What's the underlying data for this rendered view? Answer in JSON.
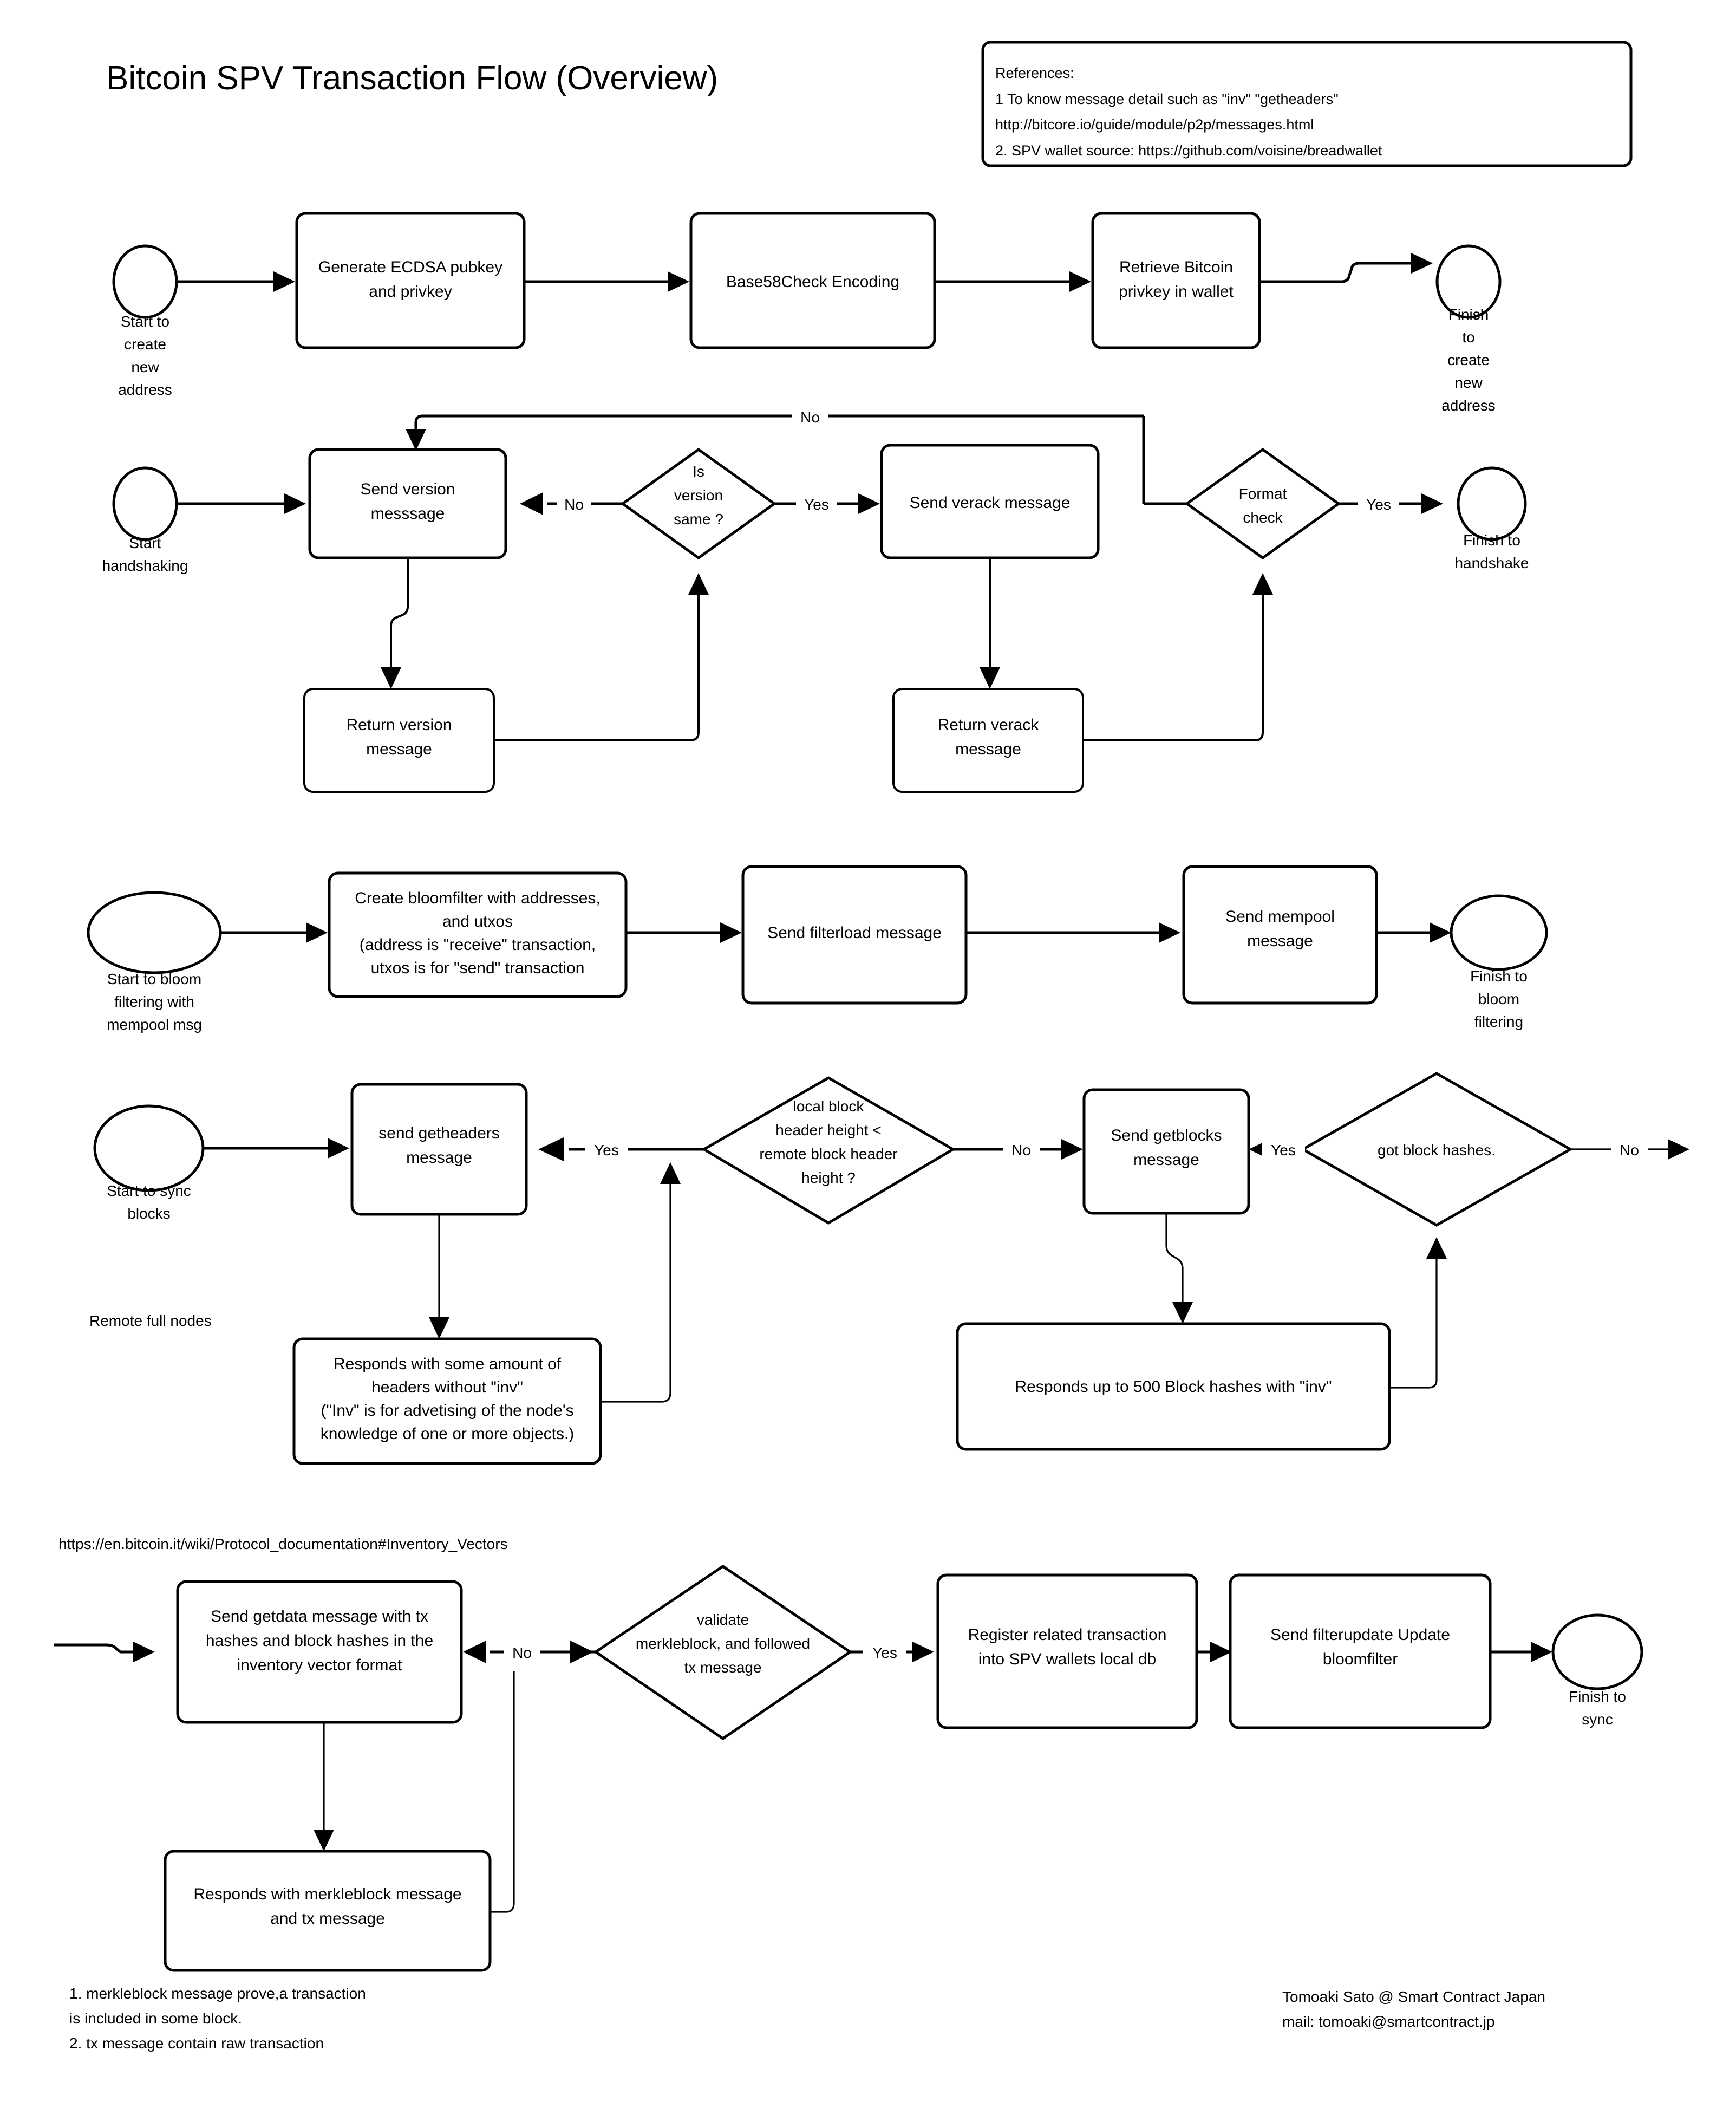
{
  "page": {
    "title": "Bitcoin SPV Transaction Flow (Overview)",
    "background": "#ffffff",
    "stroke": "#000000"
  },
  "references": {
    "lines": [
      "References:",
      "1 To know message detail such as \"inv\" \"getheaders\"",
      "http://bitcore.io/guide/module/p2p/messages.html",
      "2. SPV wallet source:  https://github.com/voisine/breadwallet"
    ]
  },
  "lane1": {
    "start": "Start to\ncreate\nnew\naddress",
    "start_lines": [
      "Start to",
      "create",
      "new",
      "address"
    ],
    "steps": [
      {
        "lines": [
          "Generate ECDSA pubkey",
          "and privkey"
        ]
      },
      {
        "lines": [
          "Base58Check Encoding"
        ]
      },
      {
        "lines": [
          "Retrieve Bitcoin",
          "privkey in wallet"
        ]
      }
    ],
    "finish_lines": [
      "Finish",
      "to",
      "create",
      "new",
      "address"
    ]
  },
  "lane2": {
    "start_lines": [
      "Start",
      "handshaking"
    ],
    "send_version_lines": [
      "Send version",
      "messsage"
    ],
    "is_version_same_lines": [
      "Is",
      "version",
      "same ?"
    ],
    "send_verack_lines": [
      "Send verack message"
    ],
    "format_check_lines": [
      "Format",
      "check"
    ],
    "finish_lines": [
      "Finish to",
      "handshake"
    ],
    "return_version_lines": [
      "Return version",
      "message"
    ],
    "return_verack_lines": [
      "Return verack",
      "message"
    ],
    "labels": {
      "no_top": "No",
      "no_left": "No",
      "yes_mid": "Yes",
      "yes_right": "Yes"
    }
  },
  "lane3": {
    "start_lines": [
      "Start to  bloom",
      "filtering with",
      "mempool msg"
    ],
    "bloomfilter_lines": [
      "Create bloomfilter with addresses,",
      "and utxos",
      "(address is \"receive\" transaction,",
      "utxos is for \"send\" transaction"
    ],
    "filterload_lines": [
      "Send filterload message"
    ],
    "mempool_lines": [
      "Send mempool",
      "message"
    ],
    "finish_lines": [
      "Finish to",
      "bloom",
      "filtering"
    ]
  },
  "lane4": {
    "start_lines": [
      "Start to sync",
      "blocks"
    ],
    "getheaders_lines": [
      "send getheaders",
      "message"
    ],
    "height_check_lines": [
      "local block",
      "header height <",
      "remote block  header",
      "height ?"
    ],
    "getblocks_lines": [
      "Send getblocks",
      "message"
    ],
    "got_hashes_lines": [
      "got block hashes."
    ],
    "remote_nodes_label": "Remote full nodes",
    "headers_response_lines": [
      "Responds with some amount of",
      "headers without \"inv\"",
      "(\"Inv\" is for advetising of the node's",
      "knowledge of one or more objects.)"
    ],
    "hashes_response_lines": [
      "Responds up to 500 Block hashes  with \"inv\""
    ],
    "labels": {
      "yes_left": "Yes",
      "no_mid": "No",
      "yes_right": "Yes",
      "no_far": "No"
    }
  },
  "lane5": {
    "wiki_url": "https://en.bitcoin.it/wiki/Protocol_documentation#Inventory_Vectors",
    "getdata_lines": [
      "Send getdata message with tx",
      "hashes and block hashes in the",
      "inventory vector format"
    ],
    "validate_lines": [
      "validate",
      "merkleblock, and followed",
      "tx message"
    ],
    "register_lines": [
      "Register related transaction",
      "into SPV wallets local db"
    ],
    "filterupdate_lines": [
      "Send filterupdate Update",
      "bloomfilter"
    ],
    "finish_lines": [
      "Finish to",
      "sync"
    ],
    "merkleblock_response_lines": [
      "Responds with merkleblock message",
      "and tx message"
    ],
    "labels": {
      "no_mid": "No",
      "yes_right": "Yes"
    }
  },
  "footnotes": {
    "lines": [
      "1. merkleblock message prove,a transaction",
      "is included in some block.",
      "2. tx message contain raw transaction"
    ]
  },
  "author": {
    "lines": [
      "Tomoaki Sato @ Smart Contract  Japan",
      "mail: tomoaki@smartcontract.jp"
    ]
  }
}
